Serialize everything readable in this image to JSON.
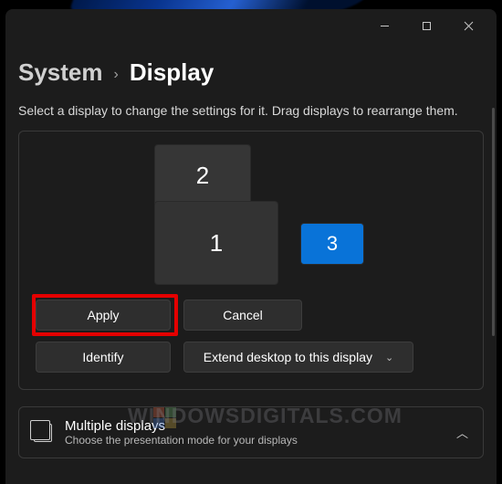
{
  "breadcrumb": {
    "parent": "System",
    "separator": "›",
    "current": "Display"
  },
  "subtitle": "Select a display to change the settings for it. Drag displays to rearrange them.",
  "displays": [
    {
      "id": "1",
      "selected": false
    },
    {
      "id": "2",
      "selected": false
    },
    {
      "id": "3",
      "selected": true
    }
  ],
  "buttons": {
    "apply": "Apply",
    "cancel": "Cancel",
    "identify": "Identify",
    "extend": "Extend desktop to this display"
  },
  "section": {
    "title": "Multiple displays",
    "subtitle": "Choose the presentation mode for your displays"
  },
  "watermark": "WINDOWSDIGITALS.COM"
}
